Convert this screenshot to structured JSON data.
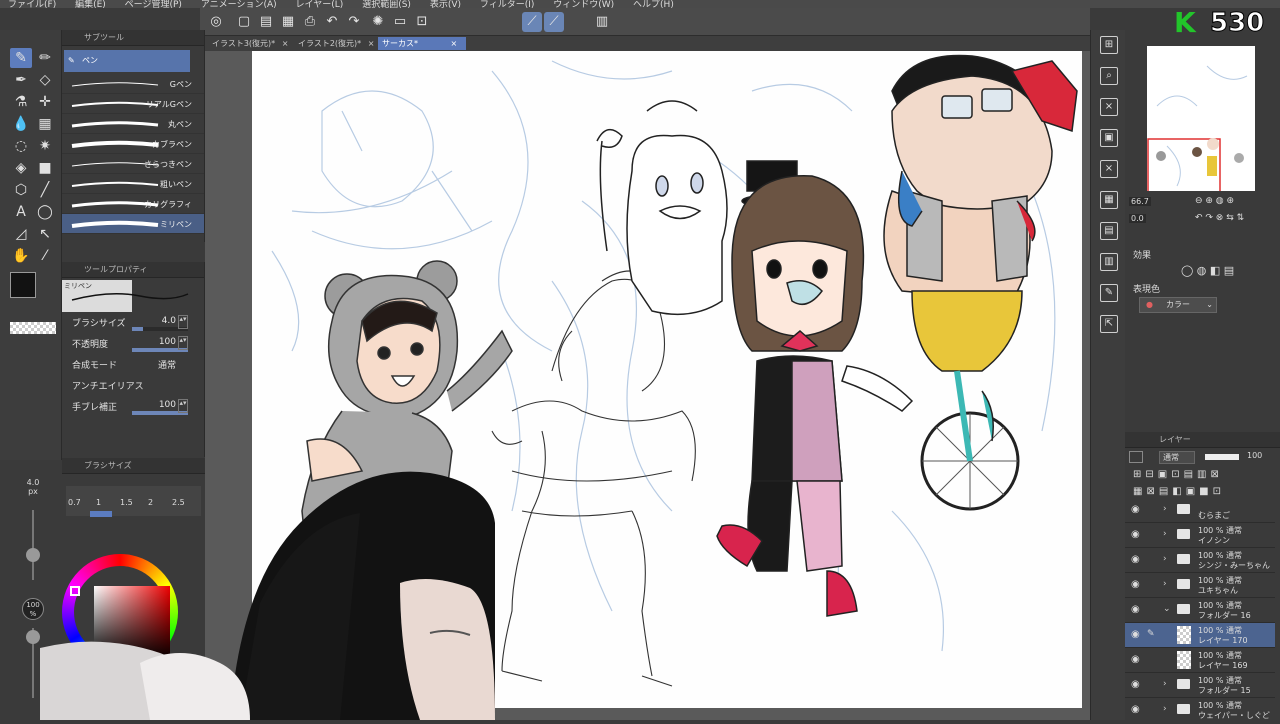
{
  "menu": [
    "ファイル(F)",
    "編集(E)",
    "ページ管理(P)",
    "アニメーション(A)",
    "レイヤー(L)",
    "選択範囲(S)",
    "表示(V)",
    "フィルター(I)",
    "ウィンドウ(W)",
    "ヘルプ(H)"
  ],
  "logo": {
    "letter": "K",
    "count": "530",
    "accent": "#22c52a"
  },
  "tabs": [
    {
      "label": "イラスト3(復元)*",
      "active": false
    },
    {
      "label": "イラスト2(復元)*",
      "active": false
    },
    {
      "label": "サーカス*",
      "active": true
    }
  ],
  "subtool": {
    "header": "サブツール",
    "group_tab": "ペン",
    "brushes": [
      "Gペン",
      "リアルGペン",
      "丸ペン",
      "カブラペン",
      "さらつきペン",
      "粗いペン",
      "カリグラフィ",
      "ミリペン"
    ],
    "selected_index": 7
  },
  "toolprop": {
    "header": "ツールプロパティ",
    "preview_label": "ミリペン",
    "rows": [
      {
        "label": "ブラシサイズ",
        "value": "4.0",
        "fill": 0.2
      },
      {
        "label": "不透明度",
        "value": "100",
        "fill": 1.0
      },
      {
        "label": "合成モード",
        "value": "通常"
      },
      {
        "label": "アンチエイリアス",
        "value": ""
      },
      {
        "label": "手ブレ補正",
        "value": "100",
        "fill": 1.0
      }
    ]
  },
  "brushsize": {
    "header": "ブラシサイズ",
    "values": [
      "0.7",
      "1",
      "1.5",
      "2",
      "2.5"
    ],
    "selected": "1"
  },
  "colorpanel": {
    "size_value": "4.0",
    "size_unit": "px",
    "opacity_value": "100",
    "opacity_unit": "%",
    "main_color": "#121212"
  },
  "right": {
    "zoom": "66.7",
    "rotation": "0.0",
    "effect_header": "効果",
    "expression_label": "表現色",
    "expression_value": "カラー",
    "layer_header": "レイヤー",
    "blend_mode": "通常",
    "opacity": "100"
  },
  "layers": [
    {
      "pct": "",
      "name": "むらまご",
      "type": "folder",
      "expanded": false,
      "selected": false
    },
    {
      "pct": "100 % 通常",
      "name": "イノシン",
      "type": "folder",
      "expanded": false,
      "selected": false
    },
    {
      "pct": "100 % 通常",
      "name": "シンジ・みーちゃん",
      "type": "folder",
      "expanded": false,
      "selected": false
    },
    {
      "pct": "100 % 通常",
      "name": "ユキちゃん",
      "type": "folder",
      "expanded": false,
      "selected": false
    },
    {
      "pct": "100 % 通常",
      "name": "フォルダー 16",
      "type": "folder",
      "expanded": true,
      "selected": false
    },
    {
      "pct": "100 % 通常",
      "name": "レイヤー 170",
      "type": "raster",
      "expanded": false,
      "selected": true
    },
    {
      "pct": "100 % 通常",
      "name": "レイヤー 169",
      "type": "raster",
      "expanded": false,
      "selected": false
    },
    {
      "pct": "100 % 通常",
      "name": "フォルダー 15",
      "type": "folder",
      "expanded": false,
      "selected": false
    },
    {
      "pct": "100 % 通常",
      "name": "ウェイパー・しぐど",
      "type": "folder",
      "expanded": false,
      "selected": false
    }
  ]
}
